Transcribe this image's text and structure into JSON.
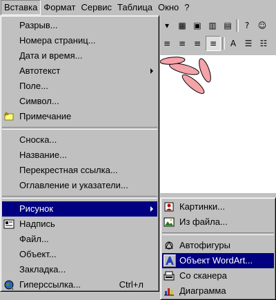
{
  "colors": {
    "menu_bg": "#c0c0c0",
    "highlight": "#000080",
    "highlight_text": "#ffffff"
  },
  "menubar": [
    {
      "label": "Вставка",
      "active": true
    },
    {
      "label": "Формат"
    },
    {
      "label": "Сервис"
    },
    {
      "label": "Таблица"
    },
    {
      "label": "Окно"
    },
    {
      "label": "?"
    }
  ],
  "menu": {
    "items": [
      {
        "label": "Разрыв..."
      },
      {
        "label": "Номера страниц..."
      },
      {
        "label": "Дата и время..."
      },
      {
        "label": "Автотекст"
      },
      {
        "label": "Поле..."
      },
      {
        "label": "Символ..."
      },
      {
        "label": "Примечание"
      },
      {
        "label": "Сноска..."
      },
      {
        "label": "Название..."
      },
      {
        "label": "Перекрестная ссылка..."
      },
      {
        "label": "Оглавление и указатели..."
      },
      {
        "label": "Рисунок"
      },
      {
        "label": "Надпись"
      },
      {
        "label": "Файл..."
      },
      {
        "label": "Объект..."
      },
      {
        "label": "Закладка..."
      },
      {
        "label": "Гиперссылка...",
        "shortcut": "Ctrl+л"
      }
    ]
  },
  "submenu": {
    "items": [
      {
        "label": "Картинки...",
        "icon": "clipart-icon"
      },
      {
        "label": "Из файла...",
        "icon": "picture-from-file-icon"
      },
      {
        "label": "Автофигуры",
        "icon": "autoshapes-icon"
      },
      {
        "label": "Объект WordArt...",
        "icon": "wordart-icon"
      },
      {
        "label": "Со сканера",
        "icon": "scanner-icon"
      },
      {
        "label": "Диаграмма",
        "icon": "chart-icon"
      }
    ]
  }
}
